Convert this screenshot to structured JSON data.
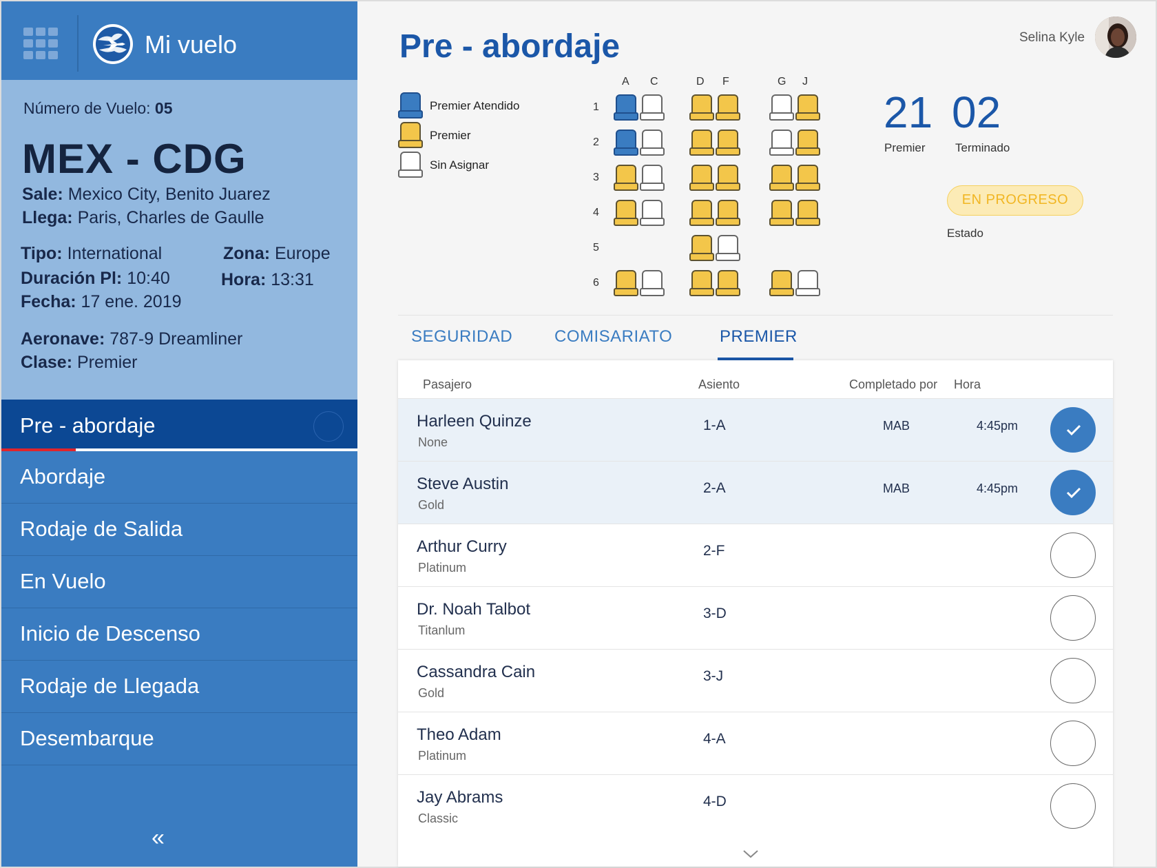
{
  "app": {
    "title": "Mi vuelo"
  },
  "flight": {
    "number_label": "Número de Vuelo:",
    "number": "05",
    "route": "MEX - CDG",
    "sale_label": "Sale:",
    "sale": "Mexico City, Benito Juarez",
    "llega_label": "Llega:",
    "llega": "Paris, Charles de Gaulle",
    "tipo_label": "Tipo:",
    "tipo": "International",
    "zona_label": "Zona:",
    "zona": "Europe",
    "duracion_label": "Duración Pl:",
    "duracion": "10:40",
    "hora_label": "Hora:",
    "hora": "13:31",
    "fecha_label": "Fecha:",
    "fecha": "17 ene. 2019",
    "aeronave_label": "Aeronave:",
    "aeronave": "787-9 Dreamliner",
    "clase_label": "Clase:",
    "clase": "Premier"
  },
  "nav": {
    "items": [
      "Pre - abordaje",
      "Abordaje",
      "Rodaje de Salida",
      "En Vuelo",
      "Inicio de Descenso",
      "Rodaje de Llegada",
      "Desembarque"
    ],
    "active_index": 0,
    "collapse_glyph": "«"
  },
  "header": {
    "title": "Pre - abordaje",
    "user_name": "Selina Kyle"
  },
  "legend": {
    "items": [
      {
        "label": "Premier Atendido",
        "state": "blue"
      },
      {
        "label": "Premier",
        "state": "yellow"
      },
      {
        "label": "Sin Asignar",
        "state": "empty"
      }
    ]
  },
  "seatmap": {
    "columns": [
      "A",
      "C",
      "D",
      "F",
      "G",
      "J"
    ],
    "rows": [
      {
        "row": "1",
        "seats": [
          "blue",
          "empty",
          "yellow",
          "yellow",
          "empty",
          "yellow"
        ]
      },
      {
        "row": "2",
        "seats": [
          "blue",
          "empty",
          "yellow",
          "yellow",
          "empty",
          "yellow"
        ]
      },
      {
        "row": "3",
        "seats": [
          "yellow",
          "empty",
          "yellow",
          "yellow",
          "yellow",
          "yellow"
        ]
      },
      {
        "row": "4",
        "seats": [
          "yellow",
          "empty",
          "yellow",
          "yellow",
          "yellow",
          "yellow"
        ]
      },
      {
        "row": "5",
        "seats": [
          null,
          null,
          "yellow",
          "empty",
          null,
          null
        ]
      },
      {
        "row": "6",
        "seats": [
          "yellow",
          "empty",
          "yellow",
          "yellow",
          "yellow",
          "empty"
        ]
      }
    ]
  },
  "stats": {
    "premier_count": "21",
    "premier_label": "Premier",
    "done_count": "02",
    "done_label": "Terminado",
    "status": "EN PROGRESO",
    "status_label": "Estado",
    "status_color": "#f1b623"
  },
  "tabs": [
    "SEGURIDAD",
    "COMISARIATO",
    "PREMIER"
  ],
  "active_tab": 2,
  "table": {
    "headers": [
      "Pasajero",
      "Asiento",
      "Completado por",
      "Hora"
    ],
    "rows": [
      {
        "name": "Harleen Quinze",
        "tier": "None",
        "seat": "1-A",
        "by": "MAB",
        "time": "4:45pm",
        "done": true
      },
      {
        "name": "Steve Austin",
        "tier": "Gold",
        "seat": "2-A",
        "by": "MAB",
        "time": "4:45pm",
        "done": true
      },
      {
        "name": "Arthur Curry",
        "tier": "Platinum",
        "seat": "2-F",
        "by": "",
        "time": "",
        "done": false
      },
      {
        "name": "Dr. Noah Talbot",
        "tier": "Titanlum",
        "seat": "3-D",
        "by": "",
        "time": "",
        "done": false
      },
      {
        "name": "Cassandra Cain",
        "tier": "Gold",
        "seat": "3-J",
        "by": "",
        "time": "",
        "done": false
      },
      {
        "name": "Theo Adam",
        "tier": "Platinum",
        "seat": "4-A",
        "by": "",
        "time": "",
        "done": false
      },
      {
        "name": "Jay Abrams",
        "tier": "Classic",
        "seat": "4-D",
        "by": "",
        "time": "",
        "done": false
      }
    ]
  },
  "colors": {
    "primary": "#3a7cc1",
    "active_nav": "#0c4894",
    "title_blue": "#1b57a8",
    "seat_yellow": "#f3c64a",
    "accent_red": "#e0242b"
  }
}
